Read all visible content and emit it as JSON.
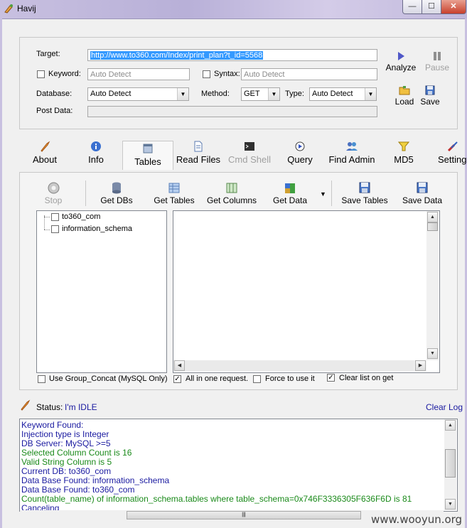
{
  "window": {
    "title": "Havij",
    "min_label": "—",
    "max_label": "☐",
    "close_label": "✕"
  },
  "form": {
    "target_label": "Target:",
    "target_value": "http://www.to360.com/Index/print_plan?t_id=5568",
    "keyword_label": "Keyword:",
    "keyword_placeholder": "Auto Detect",
    "syntax_label": "Syntax:",
    "syntax_placeholder": "Auto Detect",
    "database_label": "Database:",
    "database_value": "Auto Detect",
    "method_label": "Method:",
    "method_value": "GET",
    "type_label": "Type:",
    "type_value": "Auto Detect",
    "postdata_label": "Post Data:",
    "analyze_label": "Analyze",
    "pause_label": "Pause",
    "load_label": "Load",
    "save_label": "Save"
  },
  "tabs": [
    {
      "label": "About",
      "icon": "rocket-icon"
    },
    {
      "label": "Info",
      "icon": "info-icon"
    },
    {
      "label": "Tables",
      "icon": "table-icon",
      "active": true
    },
    {
      "label": "Read Files",
      "icon": "file-icon"
    },
    {
      "label": "Cmd Shell",
      "icon": "terminal-icon",
      "disabled": true
    },
    {
      "label": "Query",
      "icon": "query-icon"
    },
    {
      "label": "Find Admin",
      "icon": "users-icon"
    },
    {
      "label": "MD5",
      "icon": "funnel-icon"
    },
    {
      "label": "Settings",
      "icon": "tools-icon"
    }
  ],
  "toolbar": {
    "stop_label": "Stop",
    "get_dbs_label": "Get DBs",
    "get_tables_label": "Get Tables",
    "get_columns_label": "Get Columns",
    "get_data_label": "Get Data",
    "save_tables_label": "Save Tables",
    "save_data_label": "Save Data"
  },
  "tree": {
    "items": [
      {
        "label": "to360_com",
        "checked": false
      },
      {
        "label": "information_schema",
        "checked": false
      }
    ]
  },
  "options": {
    "group_concat_label": "Use Group_Concat (MySQL Only)",
    "group_concat_checked": false,
    "all_in_one_label": "All in one request.",
    "all_in_one_checked": true,
    "force_label": "Force to use it",
    "force_checked": false,
    "clear_list_label": "Clear list on get",
    "clear_list_checked": true
  },
  "status": {
    "label": "Status:",
    "value": "I'm IDLE",
    "clear_log_label": "Clear Log"
  },
  "log": {
    "lines": [
      {
        "text": "Keyword Found:",
        "color": "#1a1aa0"
      },
      {
        "text": "Injection type is Integer",
        "color": "#1a1aa0"
      },
      {
        "text": "DB Server: MySQL >=5",
        "color": "#1a1aa0"
      },
      {
        "text": "Selected Column Count is 16",
        "color": "#1a8a1a"
      },
      {
        "text": "Valid String Column is 5",
        "color": "#1a8a1a"
      },
      {
        "text": "Current DB: to360_com",
        "color": "#1a1aa0"
      },
      {
        "text": "Data Base Found: information_schema",
        "color": "#1a1aa0"
      },
      {
        "text": "Data Base Found: to360_com",
        "color": "#1a1aa0"
      },
      {
        "text": "Count(table_name) of information_schema.tables where table_schema=0x746F3336305F636F6D is 81",
        "color": "#1a8a1a"
      },
      {
        "text": "Canceling",
        "color": "#1a1aa0"
      }
    ]
  },
  "watermark": "www.wooyun.org",
  "colors": {
    "accent": "#3399ff",
    "status_blue": "#1a1aa0",
    "log_green": "#1a8a1a"
  }
}
